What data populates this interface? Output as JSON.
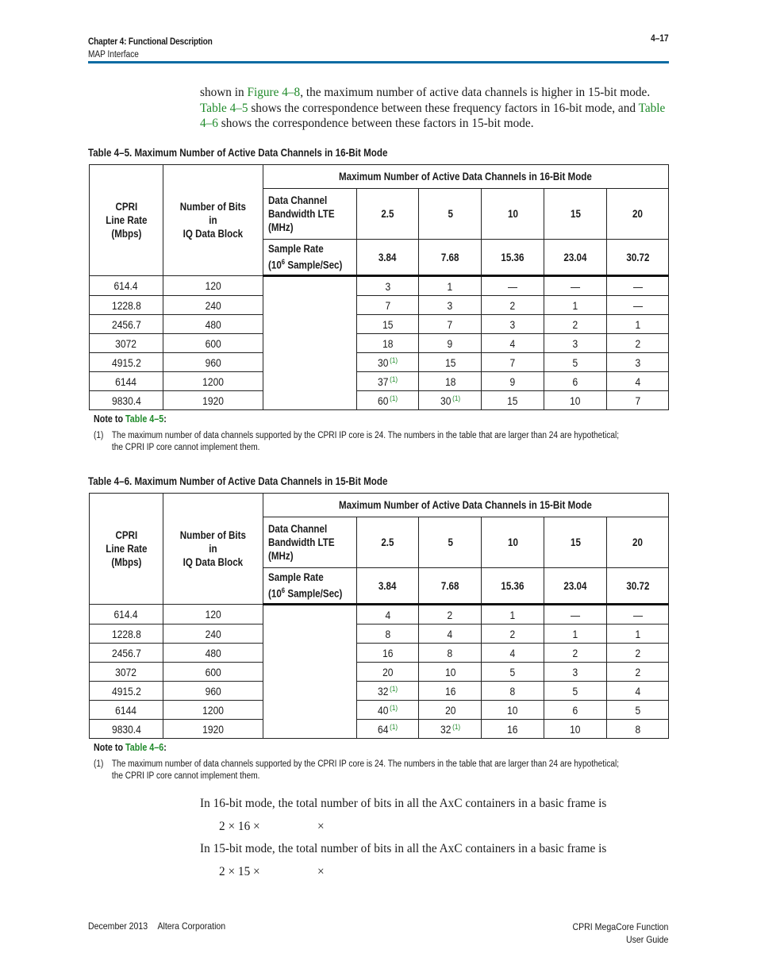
{
  "header": {
    "chapter": "Chapter 4:  Functional Description",
    "section": "MAP Interface",
    "page_number": "4–17"
  },
  "intro": {
    "t1": "shown in ",
    "link1": "Figure 4–8",
    "t2": ", the maximum number of active data channels is higher in 15-bit mode. ",
    "link2": "Table 4–5",
    "t3": " shows the correspondence between these frequency factors in 16-bit mode, and ",
    "link3": "Table 4–6",
    "t4": " shows the correspondence between these factors in 15-bit mode."
  },
  "tables": [
    {
      "caption": "Table 4–5.  Maximum Number of Active Data Channels in 16-Bit Mode",
      "col_line_rate": "CPRI\nLine Rate\n(Mbps)",
      "col_bits": "Number of Bits\nin\nIQ Data Block",
      "group_header": "Maximum Number of Active Data Channels in 16-Bit Mode",
      "bw_label": "Data Channel\nBandwidth LTE\n(MHz)",
      "bandwidths": [
        "2.5",
        "5",
        "10",
        "15",
        "20"
      ],
      "sr_label_pre": "Sample Rate",
      "sr_label_base": "(10",
      "sr_label_exp": "6",
      "sr_label_post": " Sample/Sec)",
      "sample_rates": [
        "3.84",
        "7.68",
        "15.36",
        "23.04",
        "30.72"
      ],
      "rows": [
        {
          "rate": "614.4",
          "bits": "120",
          "vals": [
            "3",
            "1",
            "—",
            "—",
            "—"
          ],
          "fn": [
            false,
            false,
            false,
            false,
            false
          ]
        },
        {
          "rate": "1228.8",
          "bits": "240",
          "vals": [
            "7",
            "3",
            "2",
            "1",
            "—"
          ],
          "fn": [
            false,
            false,
            false,
            false,
            false
          ]
        },
        {
          "rate": "2456.7",
          "bits": "480",
          "vals": [
            "15",
            "7",
            "3",
            "2",
            "1"
          ],
          "fn": [
            false,
            false,
            false,
            false,
            false
          ]
        },
        {
          "rate": "3072",
          "bits": "600",
          "vals": [
            "18",
            "9",
            "4",
            "3",
            "2"
          ],
          "fn": [
            false,
            false,
            false,
            false,
            false
          ]
        },
        {
          "rate": "4915.2",
          "bits": "960",
          "vals": [
            "30",
            "15",
            "7",
            "5",
            "3"
          ],
          "fn": [
            true,
            false,
            false,
            false,
            false
          ]
        },
        {
          "rate": "6144",
          "bits": "1200",
          "vals": [
            "37",
            "18",
            "9",
            "6",
            "4"
          ],
          "fn": [
            true,
            false,
            false,
            false,
            false
          ]
        },
        {
          "rate": "9830.4",
          "bits": "1920",
          "vals": [
            "60",
            "30",
            "15",
            "10",
            "7"
          ],
          "fn": [
            true,
            true,
            false,
            false,
            false
          ]
        }
      ],
      "footnote_mark": "(1)",
      "note_title_pre": "Note to ",
      "note_title_link": "Table 4–5",
      "note_title_post": ":",
      "note_num": "(1)",
      "note_text_1": "The maximum number of data channels supported by the CPRI IP core is 24. The numbers in the table that are larger than 24 are hypothetical;",
      "note_text_2": "the CPRI IP core cannot implement them."
    },
    {
      "caption": "Table 4–6.  Maximum Number of Active Data Channels in 15-Bit Mode",
      "col_line_rate": "CPRI\nLine Rate\n(Mbps)",
      "col_bits": "Number of Bits\nin\nIQ Data Block",
      "group_header": "Maximum Number of Active Data Channels in 15-Bit Mode",
      "bw_label": "Data Channel\nBandwidth LTE\n(MHz)",
      "bandwidths": [
        "2.5",
        "5",
        "10",
        "15",
        "20"
      ],
      "sr_label_pre": "Sample Rate",
      "sr_label_base": "(10",
      "sr_label_exp": "6",
      "sr_label_post": " Sample/Sec)",
      "sample_rates": [
        "3.84",
        "7.68",
        "15.36",
        "23.04",
        "30.72"
      ],
      "rows": [
        {
          "rate": "614.4",
          "bits": "120",
          "vals": [
            "4",
            "2",
            "1",
            "—",
            "—"
          ],
          "fn": [
            false,
            false,
            false,
            false,
            false
          ]
        },
        {
          "rate": "1228.8",
          "bits": "240",
          "vals": [
            "8",
            "4",
            "2",
            "1",
            "1"
          ],
          "fn": [
            false,
            false,
            false,
            false,
            false
          ]
        },
        {
          "rate": "2456.7",
          "bits": "480",
          "vals": [
            "16",
            "8",
            "4",
            "2",
            "2"
          ],
          "fn": [
            false,
            false,
            false,
            false,
            false
          ]
        },
        {
          "rate": "3072",
          "bits": "600",
          "vals": [
            "20",
            "10",
            "5",
            "3",
            "2"
          ],
          "fn": [
            false,
            false,
            false,
            false,
            false
          ]
        },
        {
          "rate": "4915.2",
          "bits": "960",
          "vals": [
            "32",
            "16",
            "8",
            "5",
            "4"
          ],
          "fn": [
            true,
            false,
            false,
            false,
            false
          ]
        },
        {
          "rate": "6144",
          "bits": "1200",
          "vals": [
            "40",
            "20",
            "10",
            "6",
            "5"
          ],
          "fn": [
            true,
            false,
            false,
            false,
            false
          ]
        },
        {
          "rate": "9830.4",
          "bits": "1920",
          "vals": [
            "64",
            "32",
            "16",
            "10",
            "8"
          ],
          "fn": [
            true,
            true,
            false,
            false,
            false
          ]
        }
      ],
      "footnote_mark": "(1)",
      "note_title_pre": "Note to ",
      "note_title_link": "Table 4–6",
      "note_title_post": ":",
      "note_num": "(1)",
      "note_text_1": "The maximum number of data channels supported by the CPRI IP core is 24. The numbers in the table that are larger than 24 are hypothetical;",
      "note_text_2": "the CPRI IP core cannot implement them."
    }
  ],
  "closing": {
    "p16": "In 16-bit mode, the total number of bits in all the AxC containers in a basic frame is",
    "eq16_a": "2 × 16 ×",
    "eq16_b": "×",
    "p15": "In 15-bit mode, the total number of bits in all the AxC containers in a basic frame is",
    "eq15_a": "2 × 15 ×",
    "eq15_b": "×"
  },
  "footer": {
    "date": "December 2013",
    "company": "Altera Corporation",
    "product": "CPRI MegaCore Function",
    "doc": "User Guide"
  }
}
